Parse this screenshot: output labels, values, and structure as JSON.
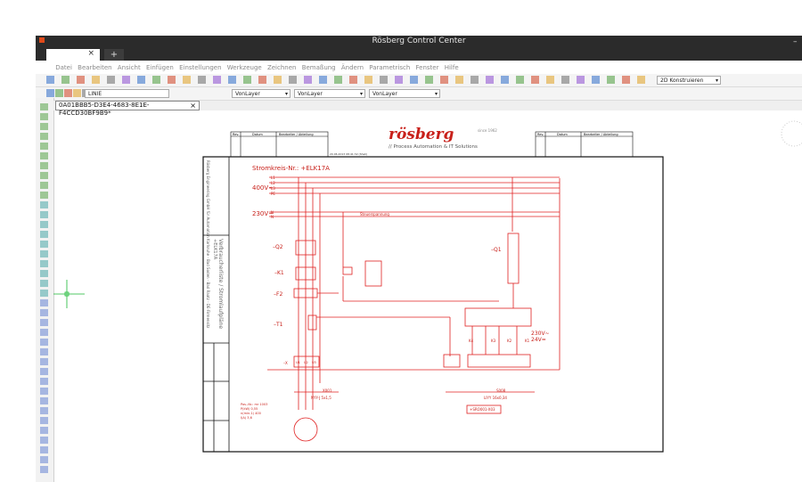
{
  "window": {
    "title": "Rösberg Control Center"
  },
  "tabs": {
    "add_label": "+",
    "close_label": "×"
  },
  "menu": [
    "Datei",
    "Bearbeiten",
    "Ansicht",
    "Einfügen",
    "Einstellungen",
    "Werkzeuge",
    "Zeichnen",
    "Bemaßung",
    "Ändern",
    "Parametrisch",
    "Fenster",
    "Hilfe"
  ],
  "toolbar": {
    "workspace": "2D Konstruieren",
    "layer": "LINIE",
    "color_layer": "VonLayer",
    "linetype": "VonLayer",
    "lineweight": "VonLayer"
  },
  "document_tab": {
    "label": "0A01BBB5-D3E4-4683-8E1E-F4CCD30BF9B9*",
    "close": "×"
  },
  "drawing": {
    "logo_word": "rösberg",
    "logo_since": "since 1962",
    "logo_tagline": "// Process Automation & IT Solutions",
    "rev_table_headers": [
      "Rev.",
      "Datum",
      "Bearbeiter / Abteilung"
    ],
    "date_stamp": "20.06.2013  08:41:32  (Shell)",
    "circuit_title": "Stromkreis-Nr.: +ELK17A",
    "voltage_400": "400V~",
    "voltage_230": "230V~",
    "phases": [
      "L1",
      "L2",
      "L3",
      "PE"
    ],
    "n_labels": [
      "N",
      "N"
    ],
    "steuer": "Steuerspannung",
    "labels": {
      "q2": "–Q2",
      "k1": "–K1",
      "f2": "–F2",
      "t1": "–T1",
      "x": "–X",
      "q1": "–Q1"
    },
    "k_labels": [
      "K4",
      "K3",
      "K2",
      "K1"
    ],
    "terminal_labels": [
      "U1",
      "U2",
      "U3"
    ],
    "box_230": "230V~",
    "box_24": "24V=",
    "cable1": [
      "X001",
      "NYY-J 5x1,5"
    ],
    "cable2": [
      "S008",
      "LIYY 16x0,34"
    ],
    "cable2_box": "+SRO001-X03",
    "motor_data": [
      "Pos.-Nr.: mr 1003",
      "P(kW) 0,55",
      "n(min-1) 400",
      "I(A) 3,6"
    ],
    "title_block_left": "Rösberg Engineering GmbH für Automation Karlsruhe - Bad Soden - Bad Raatz - DE-Firmensitz",
    "title_block_mid": "Verbraucherliste / Stromlaufpläne",
    "title_block_code": "+ELK17A"
  }
}
